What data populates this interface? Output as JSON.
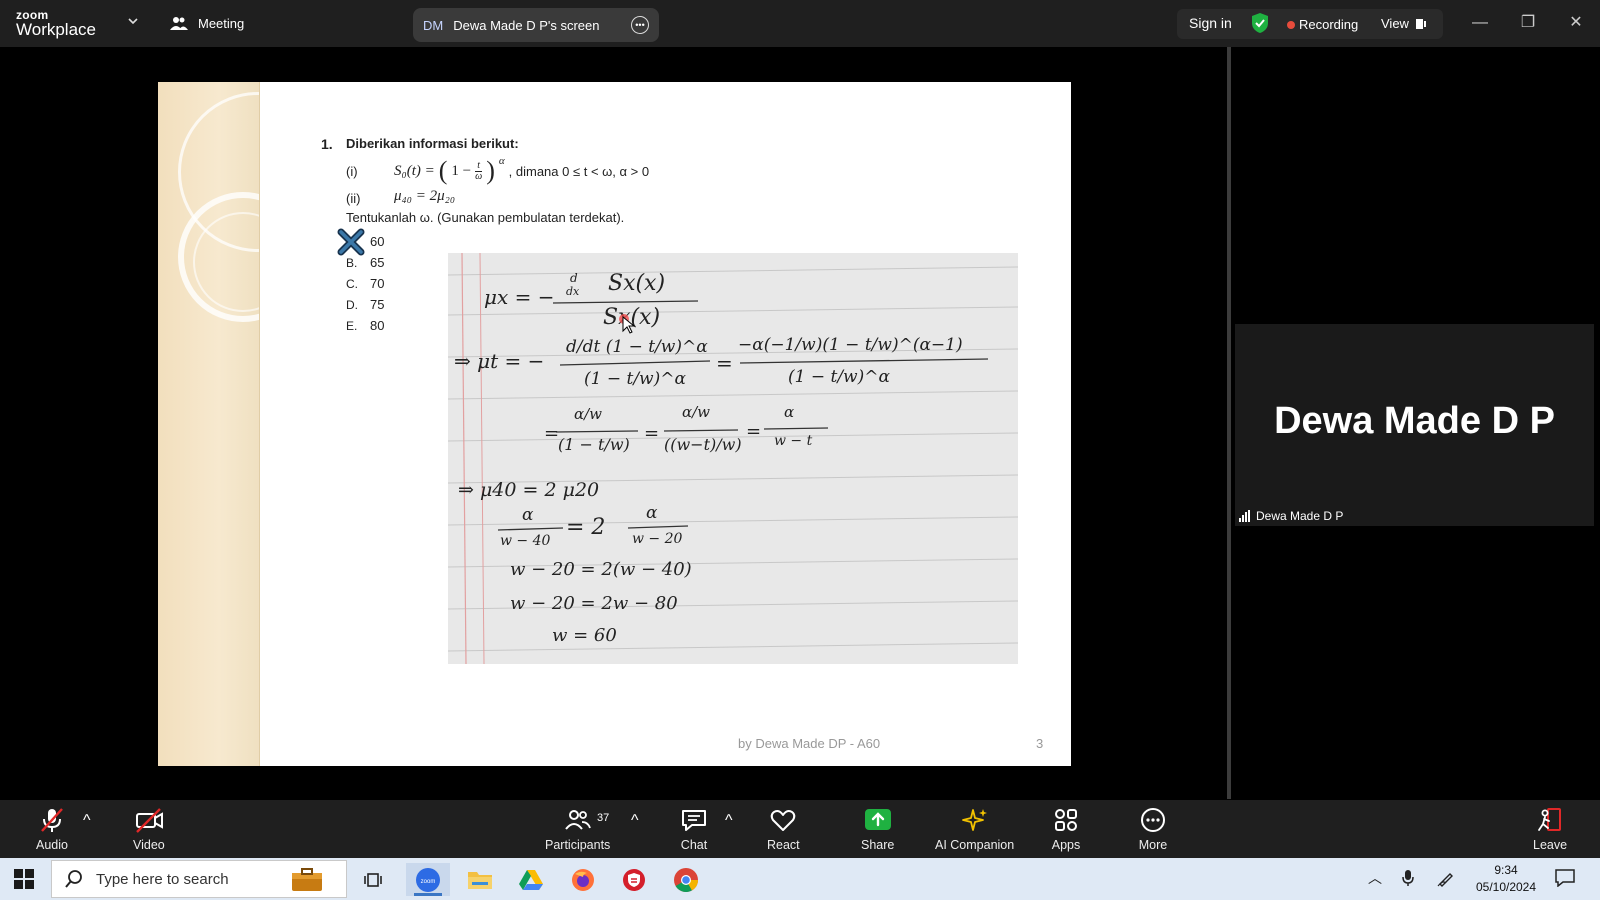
{
  "topbar": {
    "logo_small": "zoom",
    "logo_main": "Workplace",
    "meeting_label": "Meeting",
    "screen_initials": "DM",
    "screen_title": "Dewa Made D P's screen",
    "signin_label": "Sign in",
    "recording_label": "Recording",
    "view_label": "View"
  },
  "slide": {
    "question_number": "1.",
    "question_text": "Diberikan informasi berikut:",
    "item_i_label": "(i)",
    "item_i_lhs": "S₀(t) = ",
    "item_i_paren_open": "(",
    "item_i_one_minus": "1 −",
    "item_i_frac_num": "t",
    "item_i_frac_den": "ω",
    "item_i_paren_close": ")",
    "item_i_power": "α",
    "item_i_condition": ", dimana 0 ≤ t < ω,  α > 0",
    "item_ii_label": "(ii)",
    "item_ii_eq": "μ₄₀ = 2μ₂₀",
    "ask": "Tentukanlah ω. (Gunakan pembulatan terdekat).",
    "options": [
      {
        "letter": "",
        "value": "60"
      },
      {
        "letter": "B.",
        "value": "65"
      },
      {
        "letter": "C.",
        "value": "70"
      },
      {
        "letter": "D.",
        "value": "75"
      },
      {
        "letter": "E.",
        "value": "80"
      }
    ],
    "handwriting": {
      "l1_lhs": "μx = −",
      "l1_num_d": "d",
      "l1_num_dx": "dx",
      "l1_num": "Sx(x)",
      "l1_den": "Sx(x)",
      "l2_lhs": "⇒ μt = −",
      "l2_num": "d/dt (1 − t/w)^α",
      "l2_den": "(1 − t/w)^α",
      "l2_eq": "=",
      "l2_num2": "−α(−1/w)(1 − t/w)^(α−1)",
      "l2_den2": "(1 − t/w)^α",
      "l3_eq1": "=",
      "l3_f1_num": "α/w",
      "l3_f1_den": "(1 − t/w)",
      "l3_eq2": "=",
      "l3_f2_num": "α/w",
      "l3_f2_den": "((w−t)/w)",
      "l3_eq3": "=",
      "l3_f3_num": "α",
      "l3_f3_den": "w − t",
      "l4": "⇒ μ40 = 2 μ20",
      "l5_num": "α",
      "l5_den": "w − 40",
      "l5_eq": "= 2",
      "l5_num2": "α",
      "l5_den2": "w − 20",
      "l6": "w − 20  =  2(w − 40)",
      "l7": "w − 20  =  2w − 80",
      "l8": "w  =  60"
    },
    "footer": "by Dewa Made DP - A60",
    "page_number": "3"
  },
  "participant": {
    "name_big": "Dewa Made D P",
    "name_tag": "Dewa Made D P"
  },
  "toolbar": {
    "audio": "Audio",
    "video": "Video",
    "participants": "Participants",
    "participants_count": "37",
    "chat": "Chat",
    "react": "React",
    "share": "Share",
    "ai_companion": "AI Companion",
    "apps": "Apps",
    "more": "More",
    "leave": "Leave"
  },
  "taskbar": {
    "search_placeholder": "Type here to search",
    "time": "9:34",
    "date": "05/10/2024"
  },
  "colors": {
    "share_green": "#1fb141",
    "leave_red": "#e02828",
    "recording_red": "#e74c3c",
    "shield_green": "#1fb141"
  }
}
